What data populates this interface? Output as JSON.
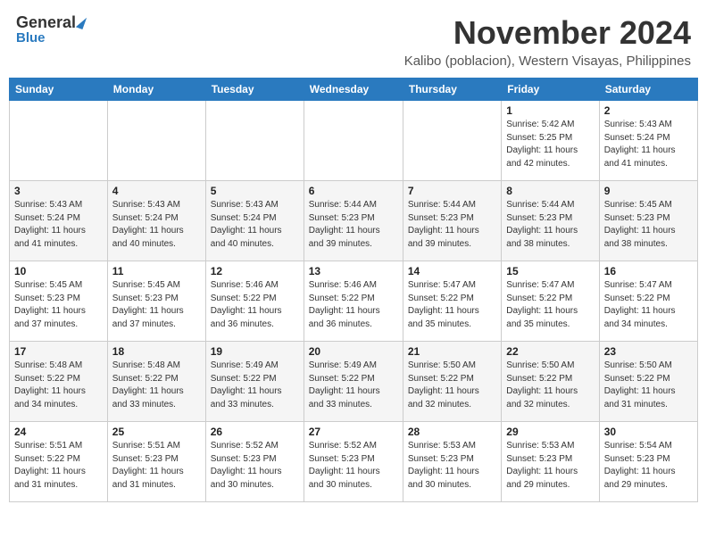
{
  "logo": {
    "general": "General",
    "blue": "Blue"
  },
  "title": "November 2024",
  "location": "Kalibo (poblacion), Western Visayas, Philippines",
  "weekdays": [
    "Sunday",
    "Monday",
    "Tuesday",
    "Wednesday",
    "Thursday",
    "Friday",
    "Saturday"
  ],
  "weeks": [
    [
      {
        "day": "",
        "info": ""
      },
      {
        "day": "",
        "info": ""
      },
      {
        "day": "",
        "info": ""
      },
      {
        "day": "",
        "info": ""
      },
      {
        "day": "",
        "info": ""
      },
      {
        "day": "1",
        "info": "Sunrise: 5:42 AM\nSunset: 5:25 PM\nDaylight: 11 hours\nand 42 minutes."
      },
      {
        "day": "2",
        "info": "Sunrise: 5:43 AM\nSunset: 5:24 PM\nDaylight: 11 hours\nand 41 minutes."
      }
    ],
    [
      {
        "day": "3",
        "info": "Sunrise: 5:43 AM\nSunset: 5:24 PM\nDaylight: 11 hours\nand 41 minutes."
      },
      {
        "day": "4",
        "info": "Sunrise: 5:43 AM\nSunset: 5:24 PM\nDaylight: 11 hours\nand 40 minutes."
      },
      {
        "day": "5",
        "info": "Sunrise: 5:43 AM\nSunset: 5:24 PM\nDaylight: 11 hours\nand 40 minutes."
      },
      {
        "day": "6",
        "info": "Sunrise: 5:44 AM\nSunset: 5:23 PM\nDaylight: 11 hours\nand 39 minutes."
      },
      {
        "day": "7",
        "info": "Sunrise: 5:44 AM\nSunset: 5:23 PM\nDaylight: 11 hours\nand 39 minutes."
      },
      {
        "day": "8",
        "info": "Sunrise: 5:44 AM\nSunset: 5:23 PM\nDaylight: 11 hours\nand 38 minutes."
      },
      {
        "day": "9",
        "info": "Sunrise: 5:45 AM\nSunset: 5:23 PM\nDaylight: 11 hours\nand 38 minutes."
      }
    ],
    [
      {
        "day": "10",
        "info": "Sunrise: 5:45 AM\nSunset: 5:23 PM\nDaylight: 11 hours\nand 37 minutes."
      },
      {
        "day": "11",
        "info": "Sunrise: 5:45 AM\nSunset: 5:23 PM\nDaylight: 11 hours\nand 37 minutes."
      },
      {
        "day": "12",
        "info": "Sunrise: 5:46 AM\nSunset: 5:22 PM\nDaylight: 11 hours\nand 36 minutes."
      },
      {
        "day": "13",
        "info": "Sunrise: 5:46 AM\nSunset: 5:22 PM\nDaylight: 11 hours\nand 36 minutes."
      },
      {
        "day": "14",
        "info": "Sunrise: 5:47 AM\nSunset: 5:22 PM\nDaylight: 11 hours\nand 35 minutes."
      },
      {
        "day": "15",
        "info": "Sunrise: 5:47 AM\nSunset: 5:22 PM\nDaylight: 11 hours\nand 35 minutes."
      },
      {
        "day": "16",
        "info": "Sunrise: 5:47 AM\nSunset: 5:22 PM\nDaylight: 11 hours\nand 34 minutes."
      }
    ],
    [
      {
        "day": "17",
        "info": "Sunrise: 5:48 AM\nSunset: 5:22 PM\nDaylight: 11 hours\nand 34 minutes."
      },
      {
        "day": "18",
        "info": "Sunrise: 5:48 AM\nSunset: 5:22 PM\nDaylight: 11 hours\nand 33 minutes."
      },
      {
        "day": "19",
        "info": "Sunrise: 5:49 AM\nSunset: 5:22 PM\nDaylight: 11 hours\nand 33 minutes."
      },
      {
        "day": "20",
        "info": "Sunrise: 5:49 AM\nSunset: 5:22 PM\nDaylight: 11 hours\nand 33 minutes."
      },
      {
        "day": "21",
        "info": "Sunrise: 5:50 AM\nSunset: 5:22 PM\nDaylight: 11 hours\nand 32 minutes."
      },
      {
        "day": "22",
        "info": "Sunrise: 5:50 AM\nSunset: 5:22 PM\nDaylight: 11 hours\nand 32 minutes."
      },
      {
        "day": "23",
        "info": "Sunrise: 5:50 AM\nSunset: 5:22 PM\nDaylight: 11 hours\nand 31 minutes."
      }
    ],
    [
      {
        "day": "24",
        "info": "Sunrise: 5:51 AM\nSunset: 5:22 PM\nDaylight: 11 hours\nand 31 minutes."
      },
      {
        "day": "25",
        "info": "Sunrise: 5:51 AM\nSunset: 5:23 PM\nDaylight: 11 hours\nand 31 minutes."
      },
      {
        "day": "26",
        "info": "Sunrise: 5:52 AM\nSunset: 5:23 PM\nDaylight: 11 hours\nand 30 minutes."
      },
      {
        "day": "27",
        "info": "Sunrise: 5:52 AM\nSunset: 5:23 PM\nDaylight: 11 hours\nand 30 minutes."
      },
      {
        "day": "28",
        "info": "Sunrise: 5:53 AM\nSunset: 5:23 PM\nDaylight: 11 hours\nand 30 minutes."
      },
      {
        "day": "29",
        "info": "Sunrise: 5:53 AM\nSunset: 5:23 PM\nDaylight: 11 hours\nand 29 minutes."
      },
      {
        "day": "30",
        "info": "Sunrise: 5:54 AM\nSunset: 5:23 PM\nDaylight: 11 hours\nand 29 minutes."
      }
    ]
  ]
}
